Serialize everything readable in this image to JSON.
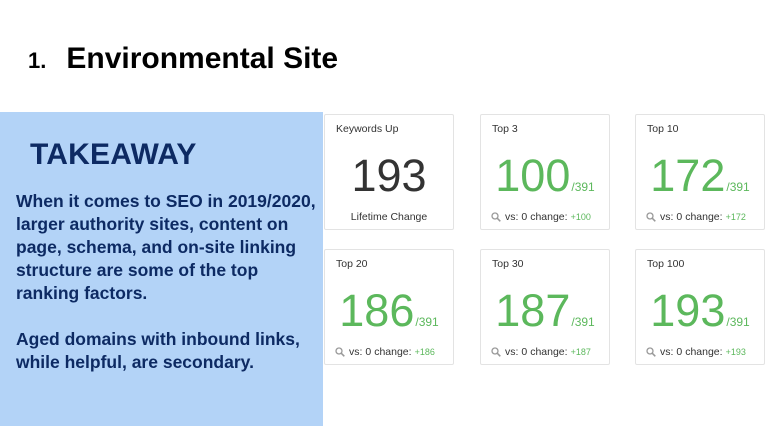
{
  "slide": {
    "number": "1.",
    "title": "Environmental Site"
  },
  "takeaway": {
    "heading": "TAKEAWAY",
    "paragraph1": "When it comes to SEO in 2019/2020, larger authority sites, content on page, schema, and on-site linking structure are some of the top ranking factors.",
    "paragraph2": "Aged domains with inbound links, while helpful, are secondary."
  },
  "cards": {
    "keywords_up": {
      "label": "Keywords Up",
      "value": "193",
      "footer": "Lifetime Change"
    },
    "top3": {
      "label": "Top 3",
      "value": "100",
      "total": "/391",
      "vs": "vs: 0",
      "change_label": "change:",
      "change": "+100"
    },
    "top10": {
      "label": "Top 10",
      "value": "172",
      "total": "/391",
      "vs": "vs: 0",
      "change_label": "change:",
      "change": "+172"
    },
    "top20": {
      "label": "Top 20",
      "value": "186",
      "total": "/391",
      "vs": "vs: 0",
      "change_label": "change:",
      "change": "+186"
    },
    "top30": {
      "label": "Top 30",
      "value": "187",
      "total": "/391",
      "vs": "vs: 0",
      "change_label": "change:",
      "change": "+187"
    },
    "top100": {
      "label": "Top 100",
      "value": "193",
      "total": "/391",
      "vs": "vs: 0",
      "change_label": "change:",
      "change": "+193"
    }
  },
  "colors": {
    "positive_green": "#5cb85c",
    "takeaway_background": "#b3d3f7",
    "takeaway_text": "#0d2a63"
  },
  "icons": {
    "footer_icon": "search-icon"
  }
}
